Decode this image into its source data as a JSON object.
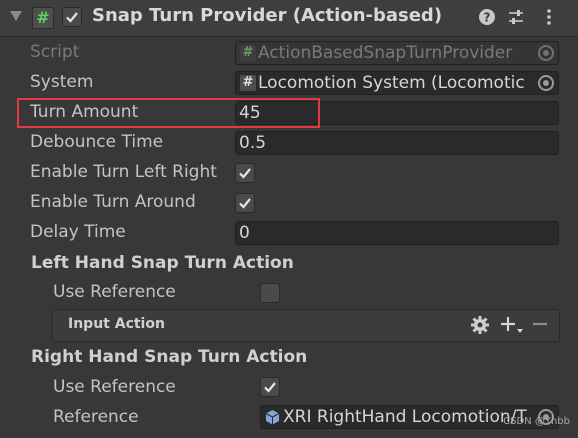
{
  "component": {
    "title": "Snap Turn Provider (Action-based)",
    "enabled": true,
    "header_icons": [
      "help-icon",
      "presets-icon",
      "menu-icon"
    ]
  },
  "fields": {
    "script": {
      "label": "Script",
      "value": "ActionBasedSnapTurnProvider"
    },
    "system": {
      "label": "System",
      "value": "Locomotion System (Locomotic"
    },
    "turn_amount": {
      "label": "Turn Amount",
      "value": "45"
    },
    "debounce_time": {
      "label": "Debounce Time",
      "value": "0.5"
    },
    "enable_turn_left_right": {
      "label": "Enable Turn Left Right",
      "checked": true
    },
    "enable_turn_around": {
      "label": "Enable Turn Around",
      "checked": true
    },
    "delay_time": {
      "label": "Delay Time",
      "value": "0"
    }
  },
  "left_hand": {
    "header": "Left Hand Snap Turn Action",
    "use_reference_label": "Use Reference",
    "use_reference": false,
    "input_action_label": "Input Action"
  },
  "right_hand": {
    "header": "Right Hand Snap Turn Action",
    "use_reference_label": "Use Reference",
    "use_reference": true,
    "reference_label": "Reference",
    "reference_value": "XRI RightHand Locomotion/T"
  },
  "watermark": "CSDN @Yhbb",
  "colors": {
    "highlight": "#e0393e",
    "script_glyph": "#5fd35f"
  }
}
